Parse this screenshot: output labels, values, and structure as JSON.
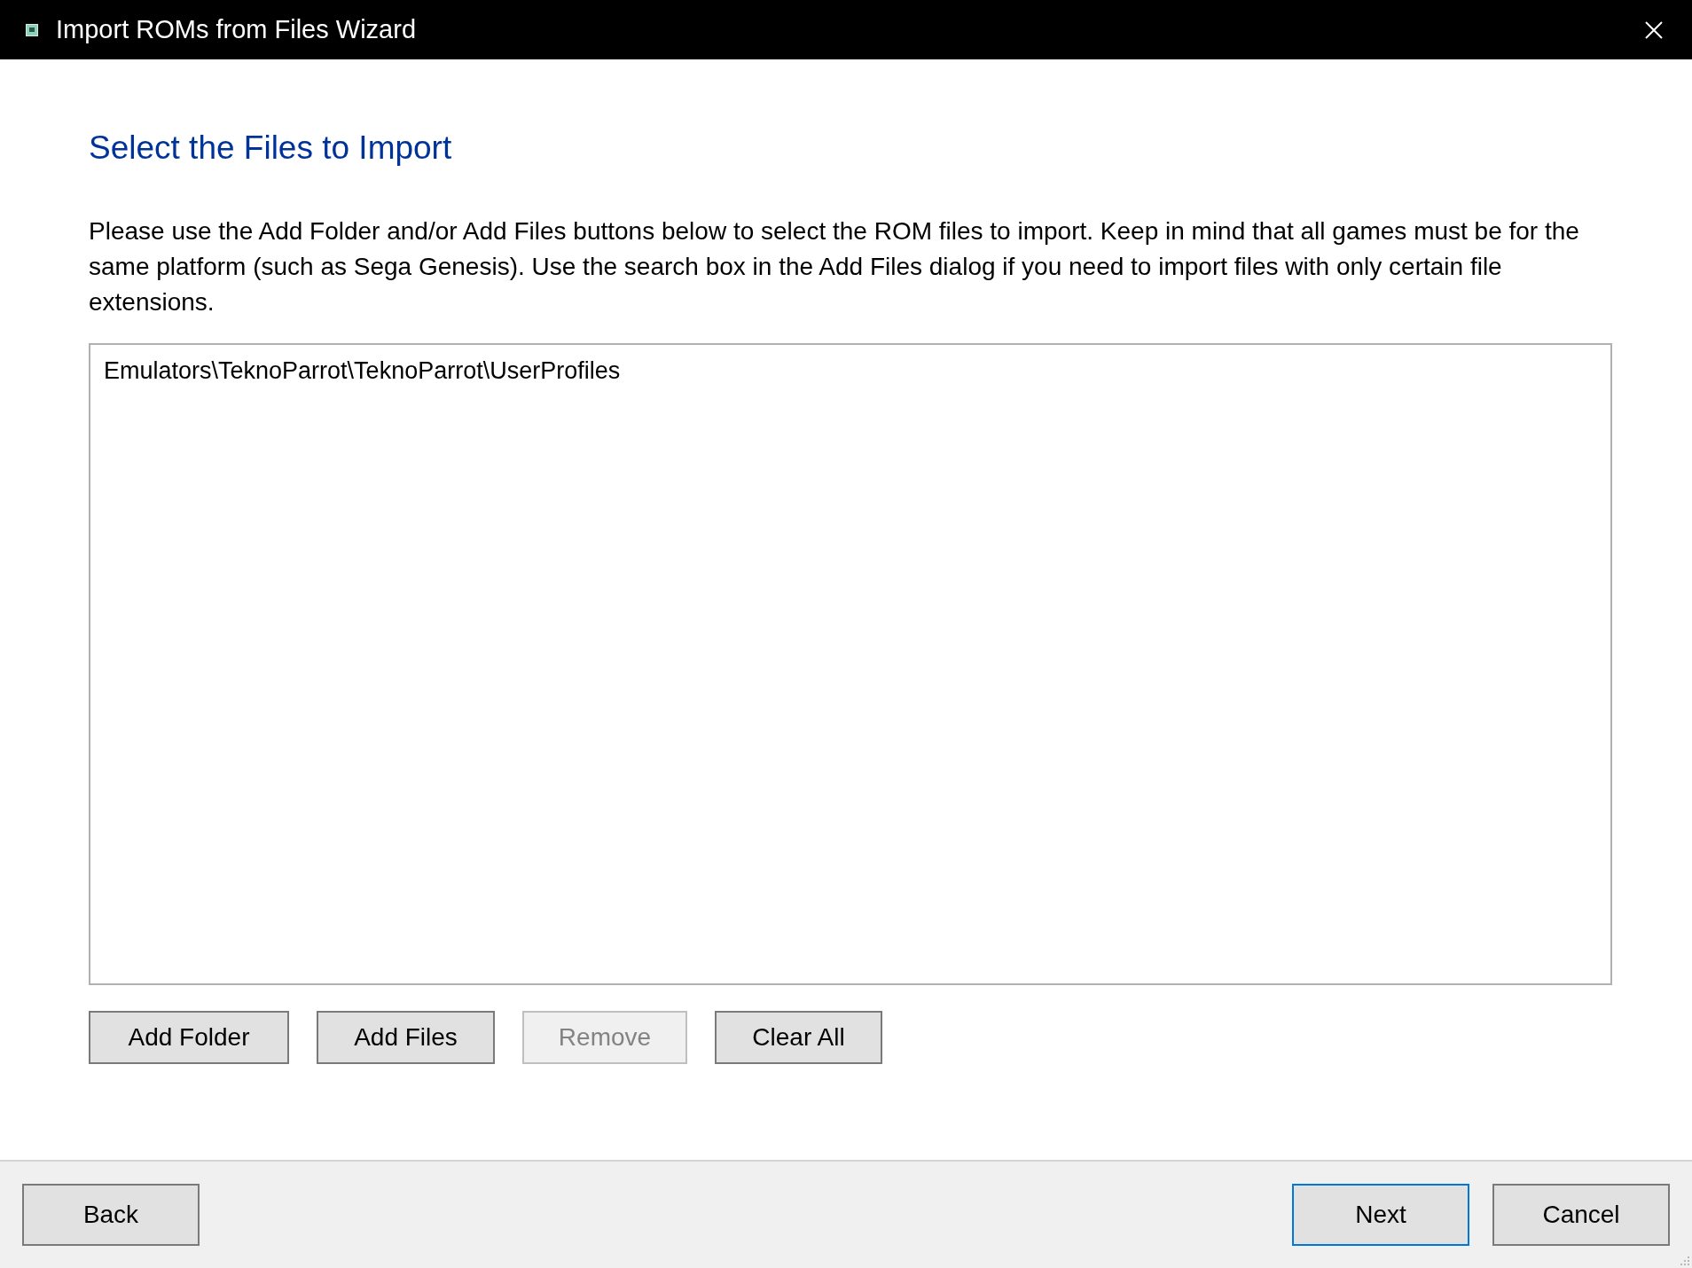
{
  "window": {
    "title": "Import ROMs from Files Wizard"
  },
  "heading": "Select the Files to Import",
  "instructions": "Please use the Add Folder and/or Add Files buttons below to select the ROM files to import. Keep in mind that all games must be for the same platform (such as Sega Genesis). Use the search box in the Add Files dialog if you need to import files with only certain file extensions.",
  "file_list": [
    "Emulators\\TeknoParrot\\TeknoParrot\\UserProfiles"
  ],
  "list_buttons": [
    {
      "label": "Add Folder",
      "disabled": false
    },
    {
      "label": "Add Files",
      "disabled": false
    },
    {
      "label": "Remove",
      "disabled": true
    },
    {
      "label": "Clear All",
      "disabled": false
    }
  ],
  "footer": {
    "left_buttons": [
      {
        "label": "Back",
        "focused": false
      }
    ],
    "right_buttons": [
      {
        "label": "Next",
        "focused": true
      },
      {
        "label": "Cancel",
        "focused": false
      }
    ]
  }
}
